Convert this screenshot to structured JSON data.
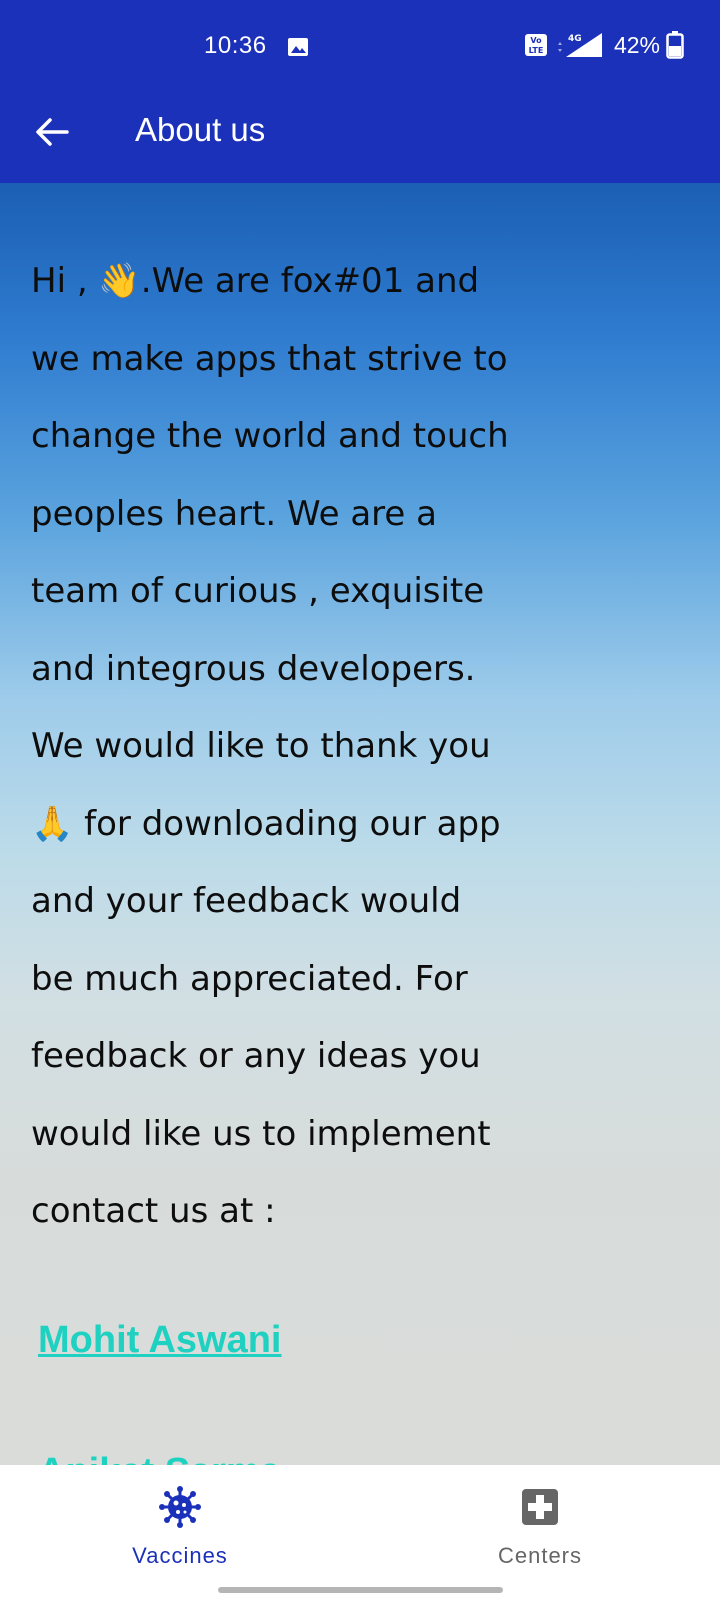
{
  "status_bar": {
    "time": "10:36",
    "network": "4G",
    "battery": "42%",
    "volte_label": "VoLTE"
  },
  "app_bar": {
    "title": "About us"
  },
  "about": {
    "lines": [
      "Hi , 👋.We are fox#01 and",
      "we make apps that strive to",
      "change the world and touch",
      "peoples heart. We are a",
      "team of curious , exquisite",
      "and integrous developers.",
      "We would like to thank you",
      "🙏 for downloading our app",
      "and your feedback would",
      "be much appreciated. For",
      "feedback or any ideas you",
      "would like us to implement",
      "contact us at :"
    ]
  },
  "contacts": [
    {
      "name": "Mohit Aswani"
    },
    {
      "name": "Aniket Sarma"
    }
  ],
  "bottom_nav": {
    "items": [
      {
        "label": "Vaccines",
        "icon": "virus-icon",
        "active": true
      },
      {
        "label": "Centers",
        "icon": "medical-cross-icon",
        "active": false
      }
    ]
  },
  "colors": {
    "primary": "#1c31b9",
    "link": "#1fd1c1",
    "inactive": "#666666"
  }
}
